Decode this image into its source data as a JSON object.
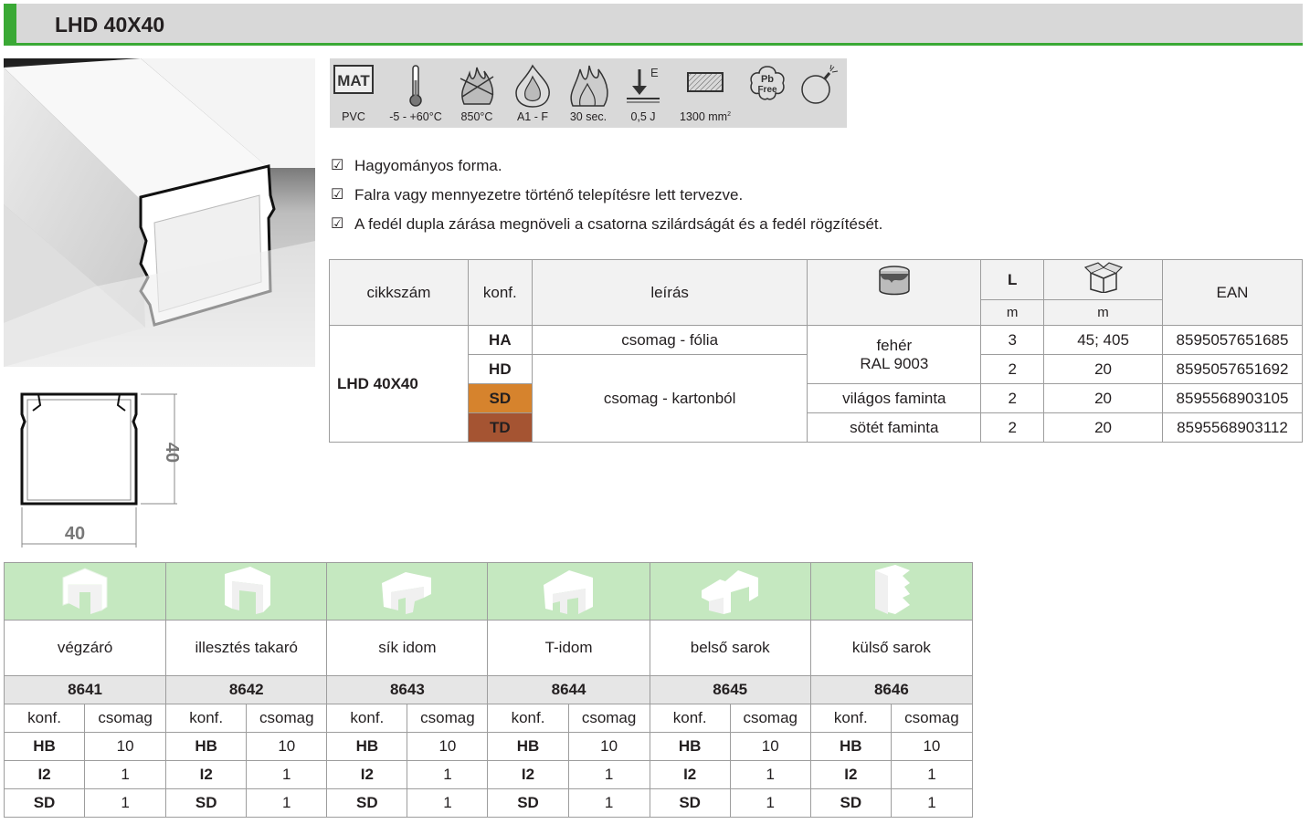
{
  "header": {
    "title": "LHD 40X40"
  },
  "cross_section": {
    "width_label": "40",
    "height_label": "40"
  },
  "icons": [
    {
      "name": "mat-icon",
      "glyph": "MAT",
      "label": "PVC"
    },
    {
      "name": "thermometer-icon",
      "label": "-5 - +60°C"
    },
    {
      "name": "glow-wire-icon",
      "label": "850°C"
    },
    {
      "name": "flame-icon",
      "label": "A1 - F"
    },
    {
      "name": "burn-time-icon",
      "label": "30 sec."
    },
    {
      "name": "impact-icon",
      "glyph": "E",
      "label": "0,5 J"
    },
    {
      "name": "cross-section-icon",
      "label": "1300 mm",
      "sup": "2"
    },
    {
      "name": "pb-free-icon",
      "glyph1": "Pb",
      "glyph2": "Free",
      "label": ""
    },
    {
      "name": "bomb-icon",
      "label": ""
    }
  ],
  "bullets": [
    "Hagyományos forma.",
    "Falra vagy mennyezetre történő telepítésre lett tervezve.",
    "A fedél dupla zárása megnöveli a csatorna szilárdságát és a fedél rögzítését."
  ],
  "main_table": {
    "headers": {
      "cikkszam": "cikkszám",
      "konf": "konf.",
      "leiras": "leírás",
      "color_icon": "paint-bucket-icon",
      "L": "L",
      "L_unit": "m",
      "box_icon": "box-icon",
      "box_unit": "m",
      "ean": "EAN"
    },
    "product": "LHD 40X40",
    "rows": [
      {
        "konf": "HA",
        "leiras": "csomag - fólia",
        "szin": "fehér",
        "szin2": "RAL 9003",
        "L": "3",
        "pack": "45; 405",
        "ean": "8595057651685"
      },
      {
        "konf": "HD",
        "leiras": "csomag - kartonból",
        "L": "2",
        "pack": "20",
        "ean": "8595057651692"
      },
      {
        "konf": "SD",
        "szin": "világos faminta",
        "L": "2",
        "pack": "20",
        "ean": "8595568903105"
      },
      {
        "konf": "TD",
        "szin": "sötét faminta",
        "L": "2",
        "pack": "20",
        "ean": "8595568903112"
      }
    ],
    "colors": {
      "SD": "#d6832d",
      "TD": "#a55432"
    }
  },
  "accessories": {
    "sub_headers": {
      "konf": "konf.",
      "csomag": "csomag"
    },
    "items": [
      {
        "name": "végzáró",
        "code": "8641",
        "rows": [
          [
            "HB",
            "10"
          ],
          [
            "I2",
            "1"
          ],
          [
            "SD",
            "1"
          ]
        ]
      },
      {
        "name": "illesztés takaró",
        "code": "8642",
        "rows": [
          [
            "HB",
            "10"
          ],
          [
            "I2",
            "1"
          ],
          [
            "SD",
            "1"
          ]
        ]
      },
      {
        "name": "sík idom",
        "code": "8643",
        "rows": [
          [
            "HB",
            "10"
          ],
          [
            "I2",
            "1"
          ],
          [
            "SD",
            "1"
          ]
        ]
      },
      {
        "name": "T-idom",
        "code": "8644",
        "rows": [
          [
            "HB",
            "10"
          ],
          [
            "I2",
            "1"
          ],
          [
            "SD",
            "1"
          ]
        ]
      },
      {
        "name": "belső sarok",
        "code": "8645",
        "rows": [
          [
            "HB",
            "10"
          ],
          [
            "I2",
            "1"
          ],
          [
            "SD",
            "1"
          ]
        ]
      },
      {
        "name": "külső sarok",
        "code": "8646",
        "rows": [
          [
            "HB",
            "10"
          ],
          [
            "I2",
            "1"
          ],
          [
            "SD",
            "1"
          ]
        ]
      }
    ]
  },
  "theme": {
    "accent": "#3aa935",
    "header_bg": "#d8d8d8",
    "acc_header_bg": "#c5e8c0"
  }
}
